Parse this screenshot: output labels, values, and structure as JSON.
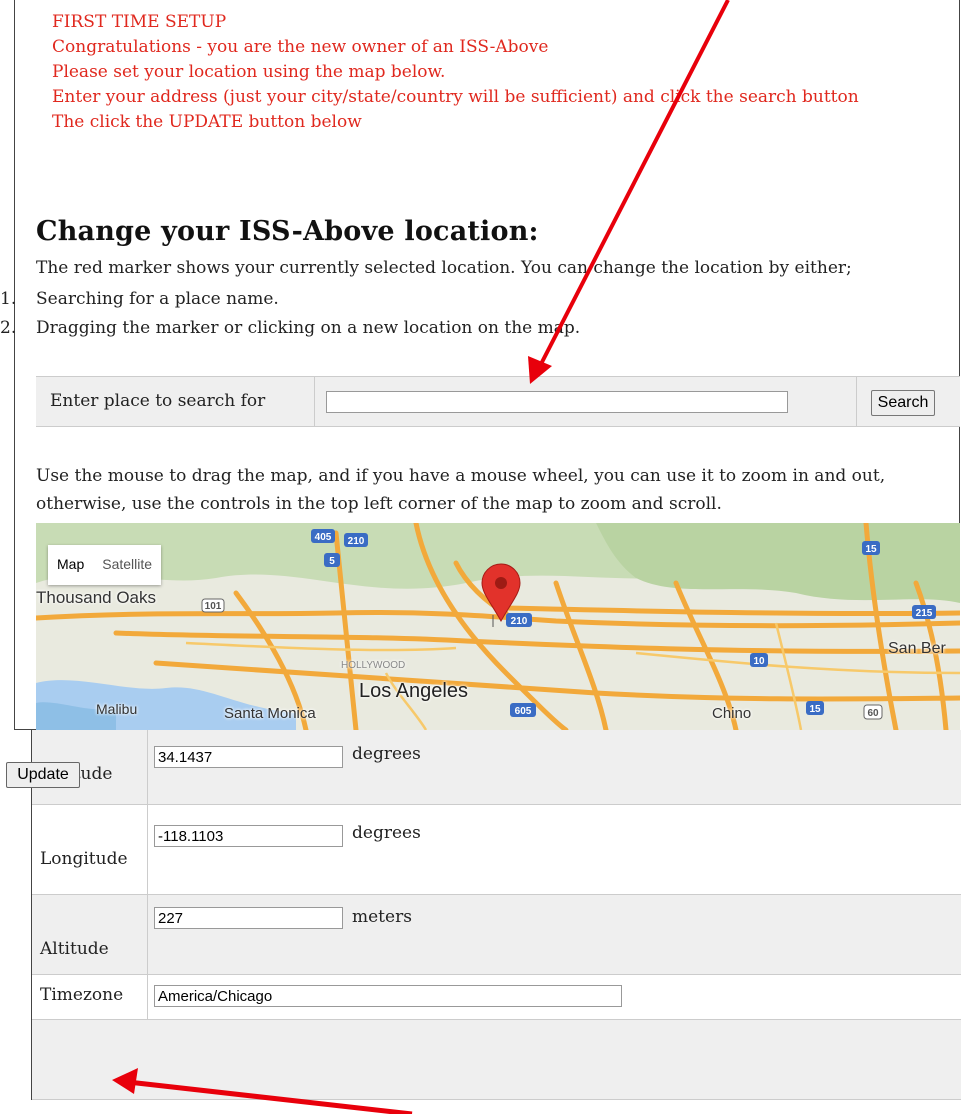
{
  "setup": {
    "lines": [
      "FIRST TIME SETUP",
      "Congratulations - you are the new owner of an ISS-Above",
      "Please set your location using the map below.",
      "Enter your address (just your city/state/country will be sufficient) and click the search button",
      "The click the UPDATE button below"
    ]
  },
  "heading": "Change your ISS-Above location:",
  "intro": "The red marker shows your currently selected location. You can change the location by either;",
  "steps": [
    {
      "num": "1.",
      "text": "Searching for a place name."
    },
    {
      "num": "2.",
      "text": "Dragging the marker or clicking on a new location on the map."
    }
  ],
  "search": {
    "label": "Enter place to search for",
    "value": "",
    "button": "Search"
  },
  "hint": "Use the mouse to drag the map, and if you have a mouse wheel, you can use it to zoom in and out, otherwise, use the controls in the top left corner of the map to zoom and scroll.",
  "map": {
    "type_map": "Map",
    "type_satellite": "Satellite",
    "places": [
      "Thousand Oaks",
      "Malibu",
      "Santa Monica",
      "Los Angeles",
      "HOLLYWOOD",
      "San Ber",
      "Chino"
    ],
    "shields": [
      "405",
      "210",
      "5",
      "101",
      "210",
      "10",
      "605",
      "15",
      "215",
      "60",
      "15"
    ]
  },
  "form": {
    "latitude": {
      "label": "Latitude",
      "value": "34.1437",
      "unit": "degrees"
    },
    "longitude": {
      "label": "Longitude",
      "value": "-118.1103",
      "unit": "degrees"
    },
    "altitude": {
      "label": "Altitude",
      "value": "227",
      "unit": "meters"
    },
    "timezone": {
      "label": "Timezone",
      "value": "America/Chicago"
    },
    "update_button": "Update"
  },
  "colors": {
    "setup_text": "#e0281e",
    "arrow": "#e8000b",
    "marker": "#e2322b"
  }
}
